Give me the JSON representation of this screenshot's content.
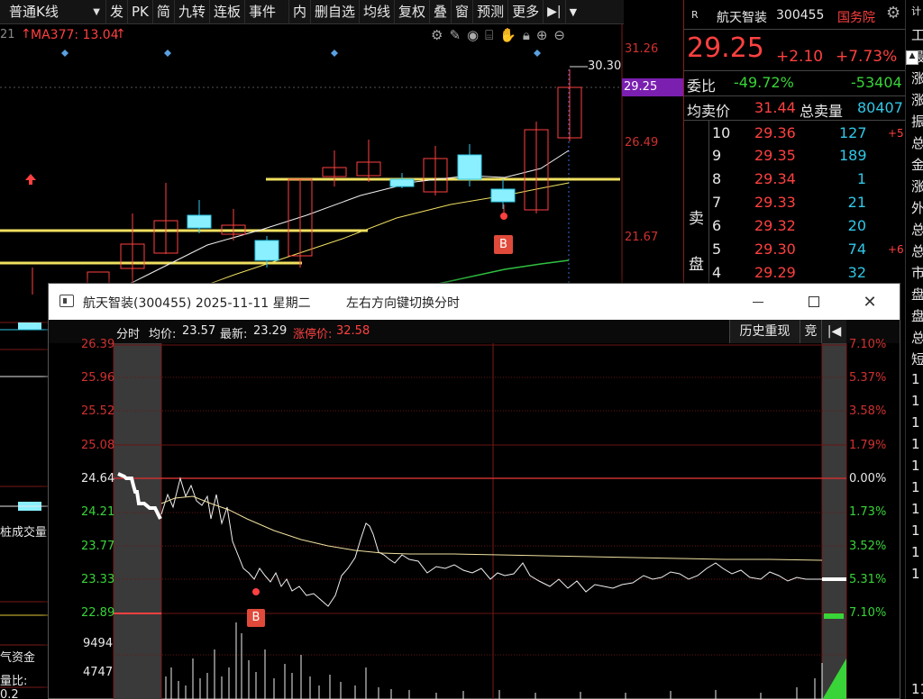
{
  "toolbar": {
    "period": "普通K线",
    "items": [
      "发",
      "PK",
      "简",
      "九转",
      "连板",
      "事件",
      "内",
      "删自选",
      "均线",
      "复权",
      "叠",
      "窗",
      "预测",
      "更多"
    ]
  },
  "kline": {
    "ma_label": "MA377: 13.04",
    "ma_prefix": "21",
    "price_axis": [
      "31.26",
      "26.49",
      "21.67"
    ],
    "current_price_tag": "29.25",
    "high_label": "30.30",
    "buy_marker": "B"
  },
  "left_panel": {
    "volume_label": "桩成交量",
    "fund_label": "气资金",
    "ratio_label": "量比: 0.2"
  },
  "quote": {
    "flag": "R",
    "stock_name": "航天智装",
    "stock_code": "300455",
    "tag": "国务院",
    "price": "29.25",
    "change": "+2.10",
    "change_pct": "+7.73%",
    "ratio_label": "委比",
    "ratio_value": "-49.72%",
    "ratio_diff": "-53404",
    "avg_label": "均卖价",
    "avg_value": "31.44",
    "total_label": "总卖量",
    "total_value": "80407",
    "side_label_1": "卖",
    "side_label_2": "盘",
    "asks": [
      {
        "level": "10",
        "price": "29.36",
        "volume": "127",
        "extra": "+5"
      },
      {
        "level": "9",
        "price": "29.35",
        "volume": "189",
        "extra": ""
      },
      {
        "level": "8",
        "price": "29.34",
        "volume": "1",
        "extra": ""
      },
      {
        "level": "7",
        "price": "29.33",
        "volume": "21",
        "extra": ""
      },
      {
        "level": "6",
        "price": "29.32",
        "volume": "20",
        "extra": ""
      },
      {
        "level": "5",
        "price": "29.30",
        "volume": "74",
        "extra": "+6"
      },
      {
        "level": "4",
        "price": "29.29",
        "volume": "32",
        "extra": ""
      }
    ]
  },
  "strip": [
    "计",
    "工",
    "最",
    "涨",
    "涨",
    "振",
    "总",
    "金",
    "涨",
    "外",
    "总",
    "总",
    "市",
    "盘",
    "盘",
    "总",
    "短",
    "1",
    "1",
    "1",
    "1",
    "1",
    "1",
    "1",
    "1",
    "1",
    "1",
    "11"
  ],
  "popup": {
    "title": "航天智装(300455) 2025-11-11 星期二",
    "hint": "左右方向键切换分时",
    "info_label": "分时",
    "avg_label": "均价:",
    "avg_value": "23.57",
    "last_label": "最新:",
    "last_value": "23.29",
    "limit_label": "涨停价:",
    "limit_value": "32.58",
    "history_button": "历史重现",
    "bid_button": "竞",
    "left_axis": [
      "26.39",
      "25.96",
      "25.52",
      "25.08",
      "24.64",
      "24.21",
      "23.77",
      "23.33",
      "22.89",
      "9494",
      "4747"
    ],
    "right_axis": [
      "7.10%",
      "5.37%",
      "3.58%",
      "1.79%",
      "0.00%",
      "1.73%",
      "3.52%",
      "5.31%",
      "7.10%"
    ],
    "buy_marker": "B"
  },
  "colors": {
    "up": "#ff4040",
    "down": "#38d438",
    "accent": "#e6c83a",
    "cyan": "#30c8e8",
    "price_tag_bg": "#7a1fb0"
  }
}
